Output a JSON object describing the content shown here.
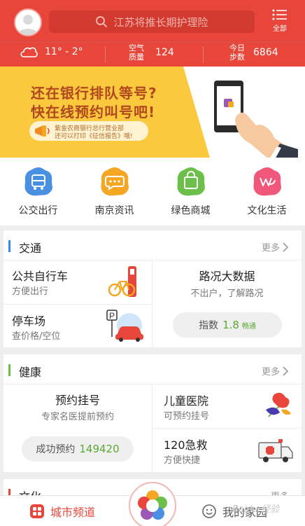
{
  "header": {
    "search_placeholder": "江苏将推长期护理险",
    "menu_label": "全部",
    "weather": {
      "temp": "11° - 2°",
      "icon": "cloud-icon"
    },
    "air": {
      "label_line1": "空气",
      "label_line2": "质量",
      "value": "124"
    },
    "steps": {
      "label_line1": "今日",
      "label_line2": "步数",
      "value": "6864"
    }
  },
  "banner": {
    "line1": "还在银行排队等号?",
    "line2": "快在线预约叫号吧!",
    "pill_line1": "紫金农商银行总行营业部",
    "pill_line2": "还可以打印《征信报告》哦!"
  },
  "categories": [
    {
      "label": "公交出行",
      "color": "#4a90e2",
      "icon": "bus-icon"
    },
    {
      "label": "南京资讯",
      "color": "#f5a623",
      "icon": "chat-icon"
    },
    {
      "label": "绿色商城",
      "color": "#6cc04a",
      "icon": "shopping-bag-icon"
    },
    {
      "label": "文化生活",
      "color": "#f0577a",
      "icon": "culture-icon"
    }
  ],
  "traffic": {
    "title": "交通",
    "more": "更多",
    "bar_color": "#2f8de4",
    "bike": {
      "title": "公共自行车",
      "sub": "方便出行"
    },
    "parking": {
      "title": "停车场",
      "sub": "查价格/空位"
    },
    "road": {
      "title": "路况大数据",
      "sub": "不出户，了解路况",
      "index_label": "指数",
      "index_value": "1.8",
      "status": "畅通"
    }
  },
  "health": {
    "title": "健康",
    "more": "更多",
    "bar_color": "#6cc04a",
    "appointment": {
      "title": "预约挂号",
      "sub": "专家名医提前预约",
      "count_label": "成功预约",
      "count_value": "149420"
    },
    "children": {
      "title": "儿童医院",
      "sub": "可预约挂号"
    },
    "emergency": {
      "title": "120急救",
      "sub": "方便快捷"
    }
  },
  "culture": {
    "title": "文化",
    "more": "更多",
    "bar_color": "#e8463a"
  },
  "bottom_nav": {
    "city_label": "城市频道",
    "home_label": "我的家园",
    "watermark": "Baidu 经验"
  }
}
